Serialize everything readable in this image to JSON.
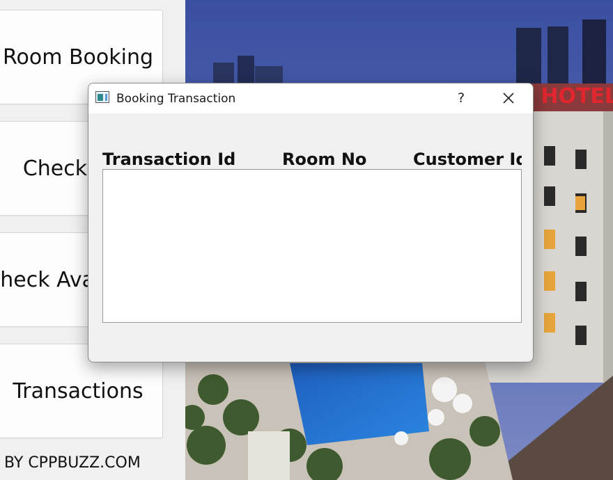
{
  "sidebar": {
    "room_booking": "Room Booking",
    "check_out": "Check-Out",
    "check_availability": "Check Availability",
    "transactions": "Transactions",
    "credit": "BY CPPBUZZ.COM"
  },
  "background": {
    "sign_text": "ibis HOTEL"
  },
  "dialog": {
    "title": "Booking Transaction",
    "help_label": "?",
    "icons": {
      "app": "window-app-icon",
      "close": "close-icon"
    },
    "table": {
      "headers": [
        "Transaction Id",
        "Room No",
        "Customer Id"
      ],
      "rows": []
    }
  },
  "colors": {
    "window_bg": "#f0f0f0",
    "titlebar_bg": "#ffffff",
    "sky": "#3b4f9a",
    "sign_red": "#d9252c"
  }
}
